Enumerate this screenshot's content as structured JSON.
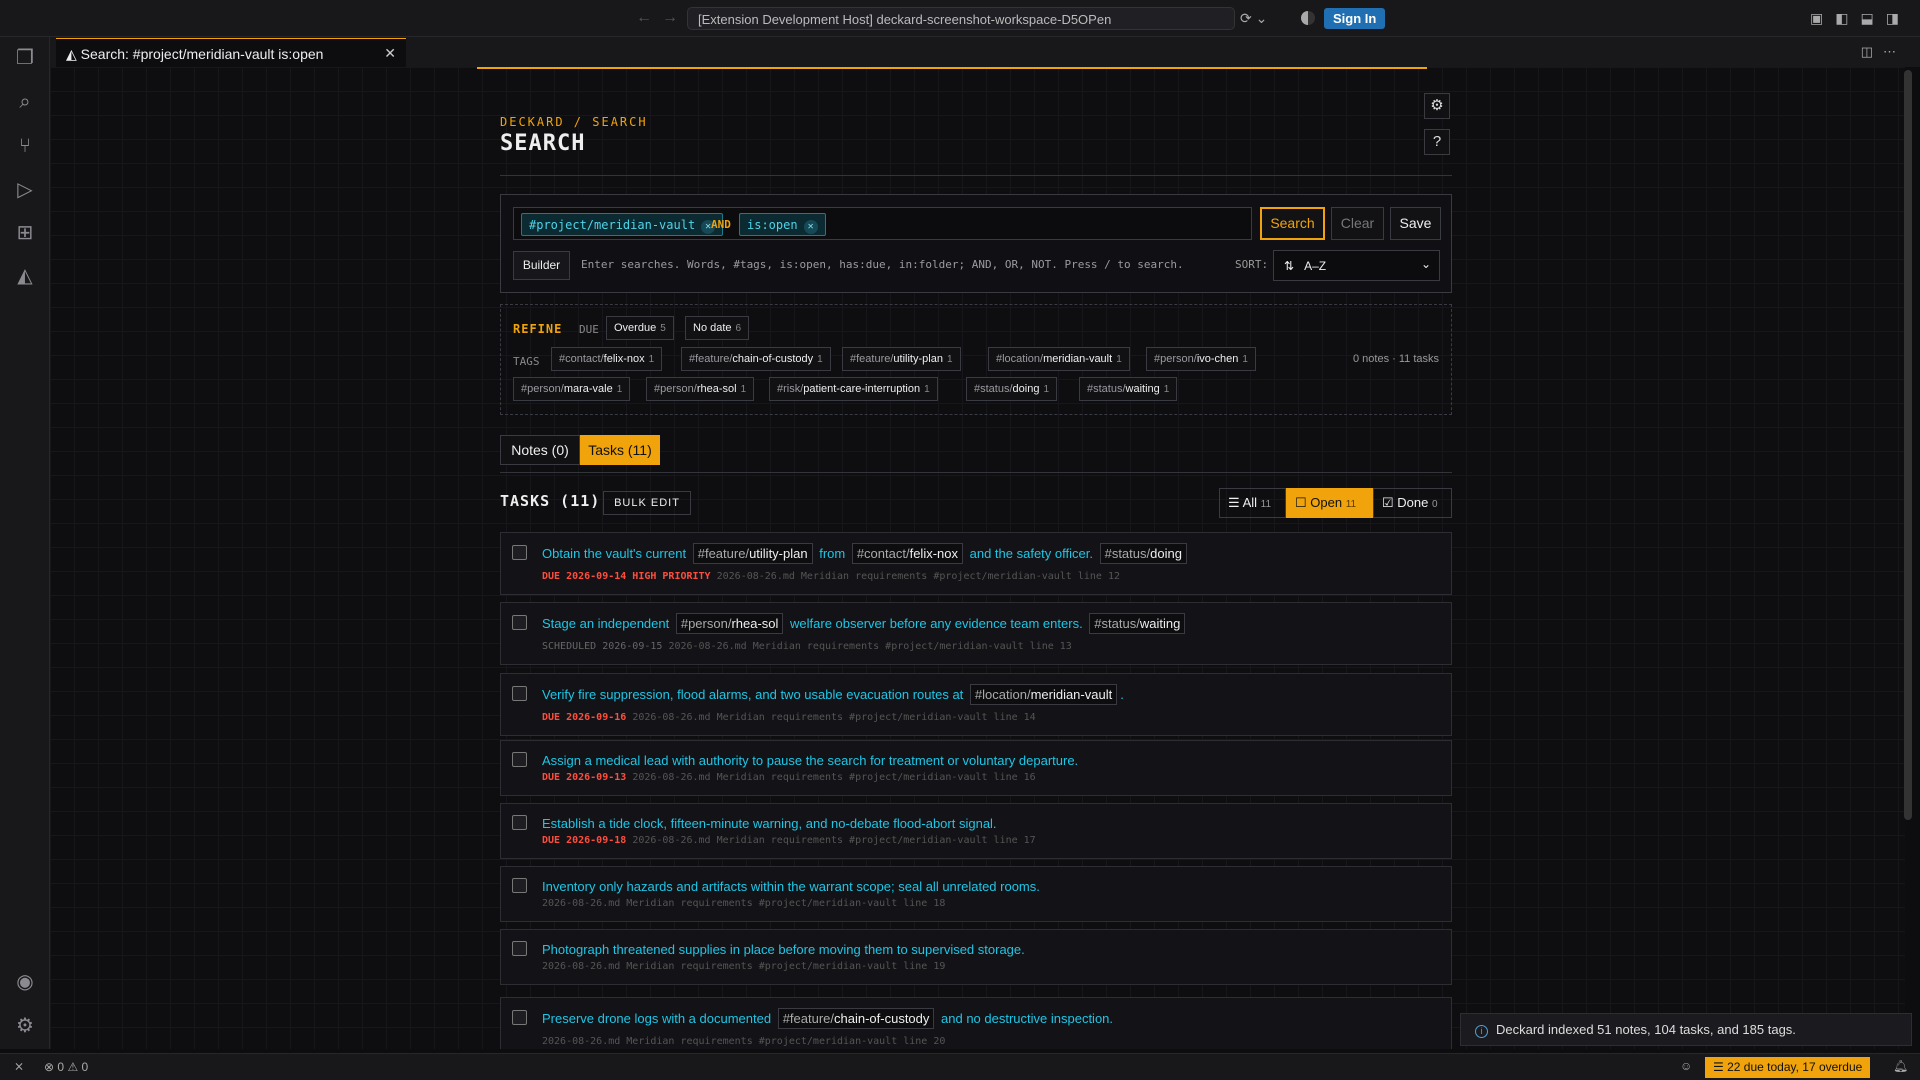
{
  "window": {
    "title": "[Extension Development Host] deckard-screenshot-workspace-D5OPen",
    "sign_in": "Sign In"
  },
  "tab": {
    "label": "Search: #project/meridian-vault is:open"
  },
  "page": {
    "breadcrumb": "DECKARD / SEARCH",
    "title": "SEARCH"
  },
  "search": {
    "chips": [
      "#project/meridian-vault",
      "is:open"
    ],
    "operator": "AND",
    "search_label": "Search",
    "clear_label": "Clear",
    "save_label": "Save",
    "builder_label": "Builder",
    "hint": "Enter searches. Words, #tags, is:open, has:due, in:folder; AND, OR, NOT. Press / to search.",
    "sort_label": "SORT:",
    "sort_value": "A–Z"
  },
  "refine": {
    "title": "REFINE",
    "due_label": "DUE",
    "due_filters": [
      {
        "label": "Overdue",
        "count": "5"
      },
      {
        "label": "No date",
        "count": "6"
      }
    ],
    "tags_label": "TAGS",
    "tags": [
      {
        "prefix": "#contact/",
        "name": "felix-nox",
        "count": "1"
      },
      {
        "prefix": "#feature/",
        "name": "chain-of-custody",
        "count": "1"
      },
      {
        "prefix": "#feature/",
        "name": "utility-plan",
        "count": "1"
      },
      {
        "prefix": "#location/",
        "name": "meridian-vault",
        "count": "1"
      },
      {
        "prefix": "#person/",
        "name": "ivo-chen",
        "count": "1"
      },
      {
        "prefix": "#person/",
        "name": "mara-vale",
        "count": "1"
      },
      {
        "prefix": "#person/",
        "name": "rhea-sol",
        "count": "1"
      },
      {
        "prefix": "#risk/",
        "name": "patient-care-interruption",
        "count": "1"
      },
      {
        "prefix": "#status/",
        "name": "doing",
        "count": "1"
      },
      {
        "prefix": "#status/",
        "name": "waiting",
        "count": "1"
      }
    ],
    "summary": "0 notes · 11 tasks"
  },
  "result_tabs": {
    "notes": "Notes (0)",
    "tasks": "Tasks (11)"
  },
  "tasks_section": {
    "heading": "TASKS (11)",
    "bulk_edit": "BULK EDIT",
    "filters": [
      {
        "label": "All",
        "count": "11"
      },
      {
        "label": "Open",
        "count": "11"
      },
      {
        "label": "Done",
        "count": "0"
      }
    ]
  },
  "tasks": [
    {
      "parts": [
        {
          "t": "text",
          "v": "Obtain the vault's current "
        },
        {
          "t": "tag",
          "p": "#feature/",
          "v": "utility-plan"
        },
        {
          "t": "text",
          "v": " from "
        },
        {
          "t": "tag",
          "p": "#contact/",
          "v": "felix-nox"
        },
        {
          "t": "text",
          "v": " and the safety officer. "
        },
        {
          "t": "tag",
          "p": "#status/",
          "v": "doing"
        }
      ],
      "due": "DUE 2026-09-14 HIGH PRIORITY",
      "scheduled": "",
      "meta": "2026-08-26.md Meridian requirements #project/meridian-vault line 12"
    },
    {
      "parts": [
        {
          "t": "text",
          "v": "Stage an independent "
        },
        {
          "t": "tag",
          "p": "#person/",
          "v": "rhea-sol"
        },
        {
          "t": "text",
          "v": " welfare observer before any evidence team enters. "
        },
        {
          "t": "tag",
          "p": "#status/",
          "v": "waiting"
        }
      ],
      "due": "",
      "scheduled": "SCHEDULED 2026-09-15",
      "meta": "2026-08-26.md Meridian requirements #project/meridian-vault line 13"
    },
    {
      "parts": [
        {
          "t": "text",
          "v": "Verify fire suppression, flood alarms, and two usable evacuation routes at "
        },
        {
          "t": "tag",
          "p": "#location/",
          "v": "meridian-vault"
        },
        {
          "t": "text",
          "v": "."
        }
      ],
      "due": "DUE 2026-09-16",
      "scheduled": "",
      "meta": "2026-08-26.md Meridian requirements #project/meridian-vault line 14"
    },
    {
      "parts": [
        {
          "t": "text",
          "v": "Assign a medical lead with authority to pause the search for treatment or voluntary departure."
        }
      ],
      "due": "DUE 2026-09-13",
      "scheduled": "",
      "meta": "2026-08-26.md Meridian requirements #project/meridian-vault line 16"
    },
    {
      "parts": [
        {
          "t": "text",
          "v": "Establish a tide clock, fifteen-minute warning, and no-debate flood-abort signal."
        }
      ],
      "due": "DUE 2026-09-18",
      "scheduled": "",
      "meta": "2026-08-26.md Meridian requirements #project/meridian-vault line 17"
    },
    {
      "parts": [
        {
          "t": "text",
          "v": "Inventory only hazards and artifacts within the warrant scope; seal all unrelated rooms."
        }
      ],
      "due": "",
      "scheduled": "",
      "meta": "2026-08-26.md Meridian requirements #project/meridian-vault line 18"
    },
    {
      "parts": [
        {
          "t": "text",
          "v": "Photograph threatened supplies in place before moving them to supervised storage."
        }
      ],
      "due": "",
      "scheduled": "",
      "meta": "2026-08-26.md Meridian requirements #project/meridian-vault line 19"
    },
    {
      "parts": [
        {
          "t": "text",
          "v": "Preserve drone logs with a documented "
        },
        {
          "t": "tag",
          "p": "#feature/",
          "v": "chain-of-custody"
        },
        {
          "t": "text",
          "v": " and no destructive inspection."
        }
      ],
      "due": "",
      "scheduled": "",
      "meta": "2026-08-26.md Meridian requirements #project/meridian-vault line 20"
    }
  ],
  "notification": {
    "text": "Deckard indexed 51 notes, 104 tasks, and 185 tags."
  },
  "statusbar": {
    "errors": "0",
    "warnings": "0",
    "deckard": "22 due today, 17 overdue"
  },
  "colors": {
    "accent": "#f0a30a",
    "link": "#1ec6e6",
    "due": "#ff4d3d"
  }
}
